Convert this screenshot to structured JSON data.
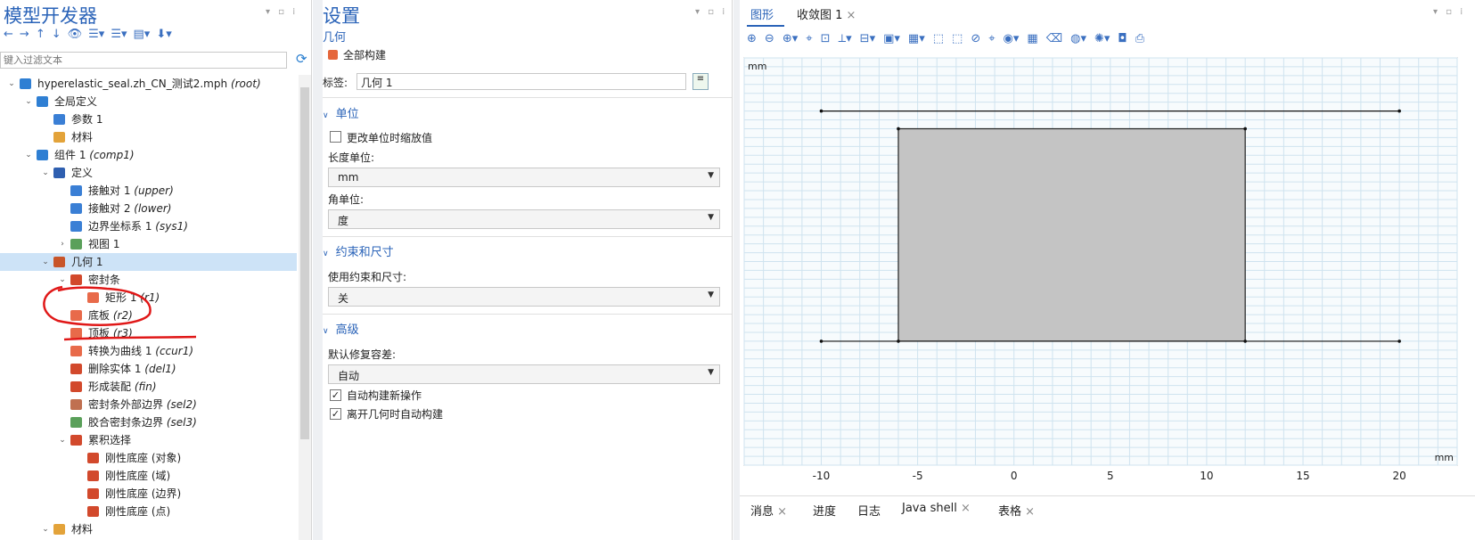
{
  "model_builder": {
    "title": "模型开发器",
    "filter_placeholder": "键入过滤文本",
    "tree": [
      {
        "depth": 0,
        "caret": "v",
        "icon": "root-icon",
        "color": "#2f7fd3",
        "label": "hyperelastic_seal.zh_CN_测试2.mph",
        "tag": "(root)"
      },
      {
        "depth": 1,
        "caret": "v",
        "icon": "globe-icon",
        "color": "#2f7fd3",
        "label": "全局定义",
        "tag": ""
      },
      {
        "depth": 2,
        "caret": "",
        "icon": "parameters-icon",
        "color": "#3a7fd5",
        "label": "参数 1",
        "tag": ""
      },
      {
        "depth": 2,
        "caret": "",
        "icon": "materials-icon",
        "color": "#e3a33a",
        "label": "材料",
        "tag": ""
      },
      {
        "depth": 1,
        "caret": "v",
        "icon": "component-icon",
        "color": "#2f7fd3",
        "label": "组件 1",
        "tag": "(comp1)"
      },
      {
        "depth": 2,
        "caret": "v",
        "icon": "definitions-icon",
        "color": "#2f5fb0",
        "label": "定义",
        "tag": ""
      },
      {
        "depth": 3,
        "caret": "",
        "icon": "contact-pair-icon",
        "color": "#3a7fd5",
        "label": "接触对 1",
        "tag": "(upper)"
      },
      {
        "depth": 3,
        "caret": "",
        "icon": "contact-pair-icon",
        "color": "#3a7fd5",
        "label": "接触对 2",
        "tag": "(lower)"
      },
      {
        "depth": 3,
        "caret": "",
        "icon": "coordinate-system-icon",
        "color": "#3a7fd5",
        "label": "边界坐标系 1",
        "tag": "(sys1)"
      },
      {
        "depth": 3,
        "caret": ">",
        "icon": "view-icon",
        "color": "#5aa05a",
        "label": "视图 1",
        "tag": ""
      },
      {
        "depth": 2,
        "caret": "v",
        "icon": "geometry-icon",
        "color": "#c8552a",
        "label": "几何 1",
        "tag": "",
        "selected": true
      },
      {
        "depth": 3,
        "caret": "v",
        "icon": "seal-icon",
        "color": "#d2492c",
        "label": "密封条",
        "tag": ""
      },
      {
        "depth": 4,
        "caret": "",
        "icon": "rectangle-icon",
        "color": "#e86a4a",
        "label": "矩形 1",
        "tag": "(r1)"
      },
      {
        "depth": 3,
        "caret": "",
        "icon": "rectangle-icon",
        "color": "#e86a4a",
        "label": "底板",
        "tag": "(r2)"
      },
      {
        "depth": 3,
        "caret": "",
        "icon": "rectangle-icon",
        "color": "#e86a4a",
        "label": "顶板",
        "tag": "(r3)"
      },
      {
        "depth": 3,
        "caret": "",
        "icon": "convert-to-curve-icon",
        "color": "#e86a4a",
        "label": "转换为曲线 1",
        "tag": "(ccur1)"
      },
      {
        "depth": 3,
        "caret": "",
        "icon": "delete-entities-icon",
        "color": "#d2492c",
        "label": "删除实体 1",
        "tag": "(del1)"
      },
      {
        "depth": 3,
        "caret": "",
        "icon": "form-assembly-icon",
        "color": "#d2492c",
        "label": "形成装配",
        "tag": "(fin)"
      },
      {
        "depth": 3,
        "caret": "",
        "icon": "selection-icon",
        "color": "#c07050",
        "label": "密封条外部边界",
        "tag": "(sel2)"
      },
      {
        "depth": 3,
        "caret": "",
        "icon": "selection-icon",
        "color": "#5aa05a",
        "label": "胶合密封条边界",
        "tag": "(sel3)"
      },
      {
        "depth": 3,
        "caret": "v",
        "icon": "cumulative-selection-icon",
        "color": "#d2492c",
        "label": "累积选择",
        "tag": ""
      },
      {
        "depth": 4,
        "caret": "",
        "icon": "selection-item-icon",
        "color": "#d2492c",
        "label": "刚性底座 (对象)",
        "tag": ""
      },
      {
        "depth": 4,
        "caret": "",
        "icon": "selection-item-icon",
        "color": "#d2492c",
        "label": "刚性底座 (域)",
        "tag": ""
      },
      {
        "depth": 4,
        "caret": "",
        "icon": "selection-item-icon",
        "color": "#d2492c",
        "label": "刚性底座 (边界)",
        "tag": ""
      },
      {
        "depth": 4,
        "caret": "",
        "icon": "selection-item-icon",
        "color": "#d2492c",
        "label": "刚性底座 (点)",
        "tag": ""
      },
      {
        "depth": 2,
        "caret": "v",
        "icon": "materials-icon",
        "color": "#e3a33a",
        "label": "材料",
        "tag": ""
      }
    ]
  },
  "settings": {
    "title": "设置",
    "subtitle": "几何",
    "build_all": "全部构建",
    "label_caption": "标签:",
    "label_value": "几何 1",
    "sections": {
      "units": "单位",
      "constraints": "约束和尺寸",
      "advanced": "高级"
    },
    "scale_values_label": "更改单位时缩放值",
    "length_unit_label": "长度单位:",
    "length_unit_value": "mm",
    "angle_unit_label": "角单位:",
    "angle_unit_value": "度",
    "use_constraints_label": "使用约束和尺寸:",
    "use_constraints_value": "关",
    "repair_tolerance_label": "默认修复容差:",
    "repair_tolerance_value": "自动",
    "auto_build_new_label": "自动构建新操作",
    "auto_build_leave_label": "离开几何时自动构建"
  },
  "graphics": {
    "tabs": [
      "图形",
      "收敛图 1"
    ],
    "bottom_tabs": [
      "消息",
      "进度",
      "日志",
      "Java shell",
      "表格"
    ],
    "unit_label": "mm",
    "colors": {
      "accent": "#2a63b8",
      "grid": "#cfe3ef",
      "shape": "#c4c4c4"
    }
  },
  "chart_data": {
    "type": "geometry",
    "xlim": [
      -14,
      23
    ],
    "ylim": [
      -7,
      16
    ],
    "xticks": [
      -10,
      -5,
      0,
      5,
      10,
      15,
      20
    ],
    "yticks": [
      -6,
      -4,
      -2,
      0,
      2,
      4,
      6,
      8,
      10,
      12,
      14,
      16
    ],
    "unit": "mm",
    "rectangles": [
      {
        "x": [
          -6,
          12
        ],
        "y": [
          0,
          12
        ]
      }
    ],
    "lines": [
      {
        "x": [
          -10,
          20
        ],
        "y": [
          13,
          13
        ]
      },
      {
        "x": [
          -10,
          20
        ],
        "y": [
          0,
          0
        ]
      }
    ]
  }
}
